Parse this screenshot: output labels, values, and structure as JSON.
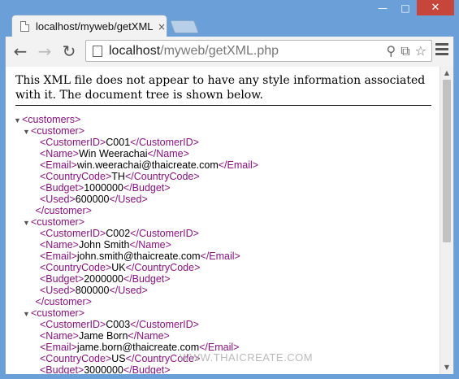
{
  "window": {
    "minimize_glyph": "—",
    "maximize_glyph": "□",
    "close_glyph": "✕"
  },
  "tab": {
    "title": "localhost/myweb/getXML",
    "close_glyph": "×"
  },
  "toolbar": {
    "back_glyph": "←",
    "forward_glyph": "→",
    "reload_glyph": "↻",
    "url_host": "localhost",
    "url_path": "/myweb/getXML.php",
    "icons": [
      "search-icon",
      "translate-icon",
      "star-icon"
    ],
    "search_glyph": "⚲",
    "translate_glyph": "⧉",
    "star_glyph": "☆"
  },
  "page": {
    "notice": "This XML file does not appear to have any style information associated with it. The document tree is shown below.",
    "watermark": "WWW.THAICREATE.COM",
    "lines": [
      {
        "indent": 0,
        "toggle": true,
        "open": "<customers>",
        "text": "",
        "close": ""
      },
      {
        "indent": 1,
        "toggle": true,
        "open": "<customer>",
        "text": "",
        "close": ""
      },
      {
        "indent": 2,
        "toggle": false,
        "open": "<CustomerID>",
        "text": "C001",
        "close": "</CustomerID>"
      },
      {
        "indent": 2,
        "toggle": false,
        "open": "<Name>",
        "text": "Win Weerachai",
        "close": "</Name>"
      },
      {
        "indent": 2,
        "toggle": false,
        "open": "<Email>",
        "text": "win.weerachai@thaicreate.com",
        "close": "</Email>"
      },
      {
        "indent": 2,
        "toggle": false,
        "open": "<CountryCode>",
        "text": "TH",
        "close": "</CountryCode>"
      },
      {
        "indent": 2,
        "toggle": false,
        "open": "<Budget>",
        "text": "1000000",
        "close": "</Budget>"
      },
      {
        "indent": 2,
        "toggle": false,
        "open": "<Used>",
        "text": "600000",
        "close": "</Used>"
      },
      {
        "indent": 1.5,
        "toggle": false,
        "open": "</customer>",
        "text": "",
        "close": ""
      },
      {
        "indent": 1,
        "toggle": true,
        "open": "<customer>",
        "text": "",
        "close": ""
      },
      {
        "indent": 2,
        "toggle": false,
        "open": "<CustomerID>",
        "text": "C002",
        "close": "</CustomerID>"
      },
      {
        "indent": 2,
        "toggle": false,
        "open": "<Name>",
        "text": "John Smith",
        "close": "</Name>"
      },
      {
        "indent": 2,
        "toggle": false,
        "open": "<Email>",
        "text": "john.smith@thaicreate.com",
        "close": "</Email>"
      },
      {
        "indent": 2,
        "toggle": false,
        "open": "<CountryCode>",
        "text": "UK",
        "close": "</CountryCode>"
      },
      {
        "indent": 2,
        "toggle": false,
        "open": "<Budget>",
        "text": "2000000",
        "close": "</Budget>"
      },
      {
        "indent": 2,
        "toggle": false,
        "open": "<Used>",
        "text": "800000",
        "close": "</Used>"
      },
      {
        "indent": 1.5,
        "toggle": false,
        "open": "</customer>",
        "text": "",
        "close": ""
      },
      {
        "indent": 1,
        "toggle": true,
        "open": "<customer>",
        "text": "",
        "close": ""
      },
      {
        "indent": 2,
        "toggle": false,
        "open": "<CustomerID>",
        "text": "C003",
        "close": "</CustomerID>"
      },
      {
        "indent": 2,
        "toggle": false,
        "open": "<Name>",
        "text": "Jame Born",
        "close": "</Name>"
      },
      {
        "indent": 2,
        "toggle": false,
        "open": "<Email>",
        "text": "jame.born@thaicreate.com",
        "close": "</Email>"
      },
      {
        "indent": 2,
        "toggle": false,
        "open": "<CountryCode>",
        "text": "US",
        "close": "</CountryCode>"
      },
      {
        "indent": 2,
        "toggle": false,
        "open": "<Budget>",
        "text": "3000000",
        "close": "</Budget>"
      }
    ]
  },
  "scrollbar": {
    "up_glyph": "▲",
    "down_glyph": "▼"
  }
}
